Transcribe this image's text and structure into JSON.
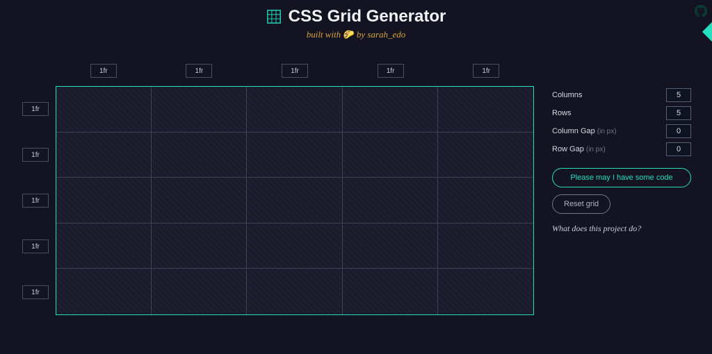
{
  "header": {
    "title": "CSS Grid Generator",
    "byline_prefix": "built with",
    "byline_emoji": "🌮",
    "byline_suffix": "by sarah_edo"
  },
  "grid": {
    "col_units": [
      "1fr",
      "1fr",
      "1fr",
      "1fr",
      "1fr"
    ],
    "row_units": [
      "1fr",
      "1fr",
      "1fr",
      "1fr",
      "1fr"
    ]
  },
  "panel": {
    "columns_label": "Columns",
    "columns_value": "5",
    "rows_label": "Rows",
    "rows_value": "5",
    "colgap_label": "Column Gap",
    "colgap_hint": "(in px)",
    "colgap_value": "0",
    "rowgap_label": "Row Gap",
    "rowgap_hint": "(in px)",
    "rowgap_value": "0",
    "code_button": "Please may I have some code",
    "reset_button": "Reset grid",
    "about_link": "What does this project do?"
  },
  "colors": {
    "accent": "#27debf",
    "bg": "#131321"
  }
}
